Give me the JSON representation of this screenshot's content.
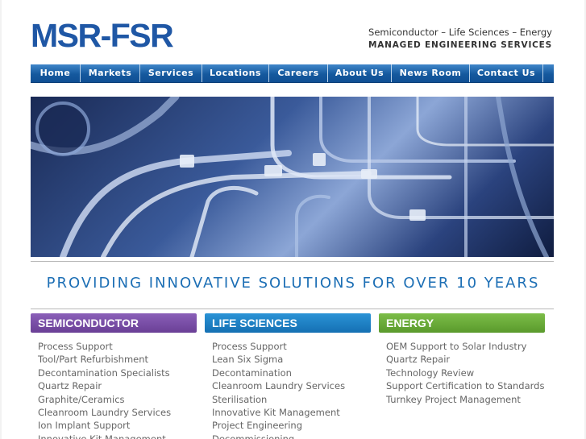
{
  "header": {
    "logo": "MSR-FSR",
    "tagline1": "Semiconductor – Life Sciences – Energy",
    "tagline2": "MANAGED ENGINEERING SERVICES"
  },
  "nav": [
    "Home",
    "Markets",
    "Services",
    "Locations",
    "Careers",
    "About Us",
    "News Room",
    "Contact Us"
  ],
  "hero": {
    "colors": {
      "dark": "#0f1c3f",
      "light": "#8ca6d6"
    }
  },
  "headline": "PROVIDING INNOVATIVE SOLUTIONS FOR OVER 10 YEARS",
  "columns": [
    {
      "title": "SEMICONDUCTOR",
      "color": "#7b4fa6",
      "items": [
        "Process Support",
        "Tool/Part Refurbishment",
        "Decontamination Specialists",
        "Quartz Repair",
        "Graphite/Ceramics",
        "Cleanroom Laundry Services",
        "Ion Implant Support",
        "Innovative Kit Management"
      ]
    },
    {
      "title": "LIFE SCIENCES",
      "color": "#1c7fc4",
      "items": [
        "Process Support",
        "Lean Six Sigma",
        "Decontamination",
        "Cleanroom Laundry Services",
        "Sterilisation",
        "Innovative Kit Management",
        "Project Engineering",
        "Decommissioning"
      ]
    },
    {
      "title": "ENERGY",
      "color": "#6aaa3a",
      "items": [
        "OEM Support to Solar Industry",
        "Quartz Repair",
        "Technology Review",
        "Support Certification to Standards",
        "Turnkey Project Management"
      ]
    }
  ]
}
